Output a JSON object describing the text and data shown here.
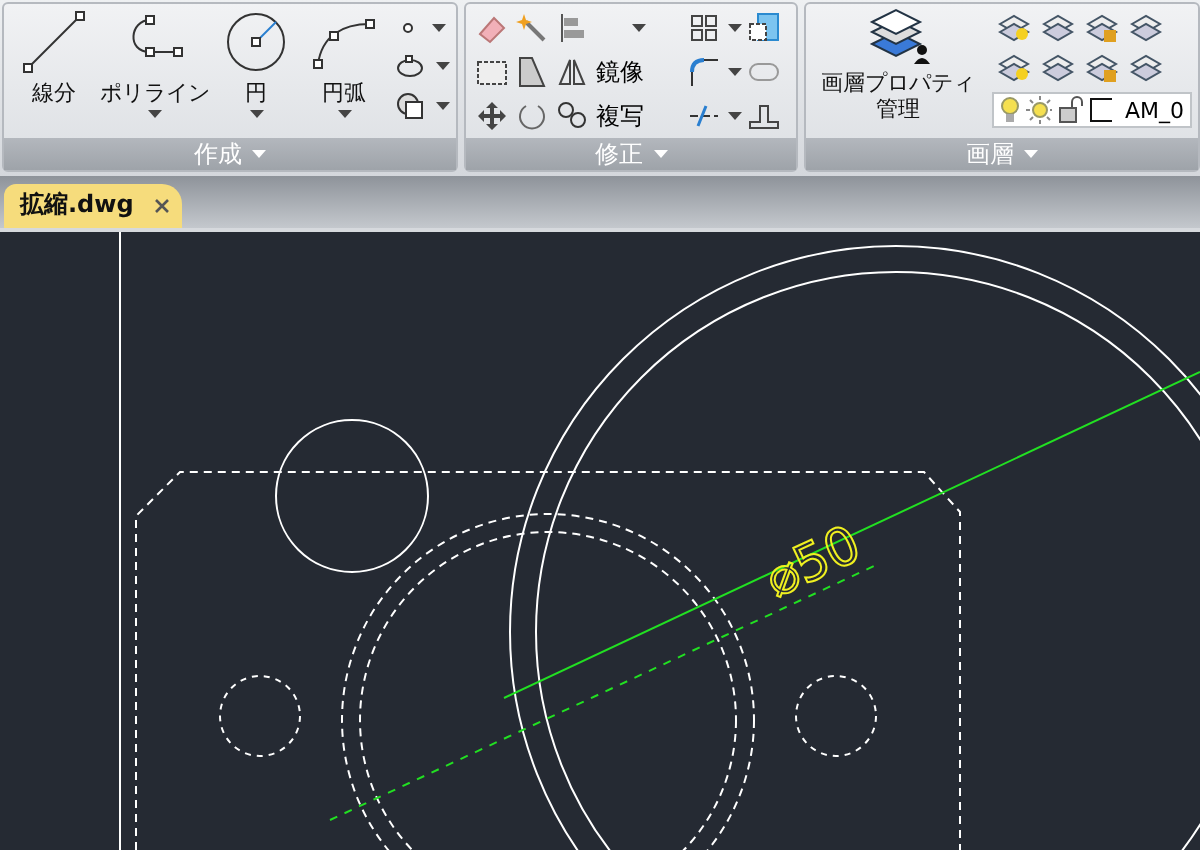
{
  "ribbon": {
    "panels": [
      {
        "title": "作成",
        "tools": [
          {
            "label": "線分",
            "dropdown": false
          },
          {
            "label": "ポリライン",
            "dropdown": true
          },
          {
            "label": "円",
            "dropdown": true
          },
          {
            "label": "円弧",
            "dropdown": true
          }
        ]
      },
      {
        "title": "修正",
        "tools": [
          {
            "label": "鏡像"
          },
          {
            "label": "複写"
          }
        ]
      },
      {
        "title": "画層",
        "tools": [
          {
            "label": "画層プロパティ管理"
          }
        ],
        "layer": "AM_0"
      }
    ]
  },
  "file_tabs": [
    {
      "label": "拡縮.dwg",
      "selected": true
    }
  ],
  "drawing": {
    "dimension": "⌀50"
  }
}
